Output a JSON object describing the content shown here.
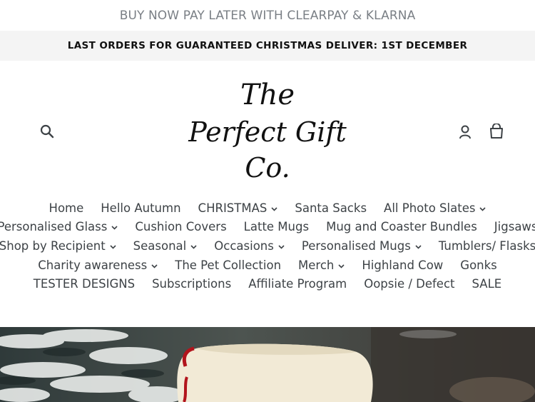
{
  "promo": {
    "text": "BUY NOW PAY LATER WITH CLEARPAY & KLARNA"
  },
  "announcement": {
    "text": "LAST ORDERS FOR GUARANTEED CHRISTMAS DELIVER: 1ST DECEMBER"
  },
  "header": {
    "logo": {
      "line1": "The",
      "line2": "Perfect Gift",
      "line3": "Co."
    },
    "icons": [
      "search-icon",
      "user-icon",
      "cart-icon"
    ]
  },
  "nav": {
    "rows": [
      [
        {
          "label": "Home",
          "dropdown": false
        },
        {
          "label": "Hello Autumn",
          "dropdown": false
        },
        {
          "label": "CHRISTMAS",
          "dropdown": true
        },
        {
          "label": "Santa Sacks",
          "dropdown": false
        },
        {
          "label": "All Photo Slates",
          "dropdown": true
        }
      ],
      [
        {
          "label": "Personalised Glass",
          "dropdown": true
        },
        {
          "label": "Cushion Covers",
          "dropdown": false
        },
        {
          "label": "Latte Mugs",
          "dropdown": false
        },
        {
          "label": "Mug and Coaster Bundles",
          "dropdown": false
        },
        {
          "label": "Jigsaws",
          "dropdown": false
        }
      ],
      [
        {
          "label": "Shop by Recipient",
          "dropdown": true
        },
        {
          "label": "Seasonal",
          "dropdown": true
        },
        {
          "label": "Occasions",
          "dropdown": true
        },
        {
          "label": "Personalised Mugs",
          "dropdown": true
        },
        {
          "label": "Tumblers/ Flasks",
          "dropdown": false
        }
      ],
      [
        {
          "label": "Charity awareness",
          "dropdown": true
        },
        {
          "label": "The Pet Collection",
          "dropdown": false
        },
        {
          "label": "Merch",
          "dropdown": true
        },
        {
          "label": "Highland Cow",
          "dropdown": false
        },
        {
          "label": "Gonks",
          "dropdown": false
        }
      ],
      [
        {
          "label": "TESTER DESIGNS",
          "dropdown": false
        },
        {
          "label": "Subscriptions",
          "dropdown": false
        },
        {
          "label": "Affiliate Program",
          "dropdown": false
        },
        {
          "label": "Oopsie / Defect",
          "dropdown": false
        },
        {
          "label": "SALE",
          "dropdown": false
        }
      ]
    ]
  },
  "colors": {
    "text": "#3d4246",
    "announcement_bg": "#f4f4f4",
    "promo_text": "#7a7f85"
  }
}
